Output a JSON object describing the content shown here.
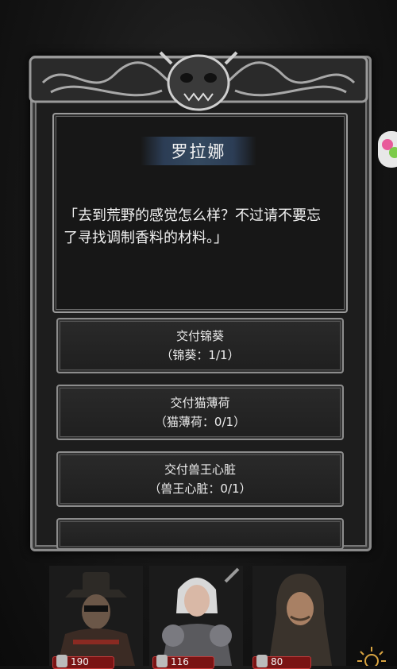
{
  "dialog": {
    "speaker": "罗拉娜",
    "line1": "「去到荒野的感觉怎么样？不过请不要忘",
    "line2": "了寻找调制香料的材料。」"
  },
  "options": [
    {
      "title": "交付锦葵",
      "detail": "（锦葵：1/1）"
    },
    {
      "title": "交付猫薄荷",
      "detail": "（猫薄荷：0/1）"
    },
    {
      "title": "交付兽王心脏",
      "detail": "（兽王心脏：0/1）"
    }
  ],
  "party": [
    {
      "hp": "190"
    },
    {
      "hp": "116"
    },
    {
      "hp": "80"
    }
  ],
  "icons": {
    "frame_ornament": "demon-skull-icon",
    "side_bubble": "chat-bubble-icon",
    "hp_icon": "sword-icon",
    "corner": "sun-icon"
  },
  "colors": {
    "hp_bar": "#7a1414",
    "name_plate": "#34495f"
  }
}
